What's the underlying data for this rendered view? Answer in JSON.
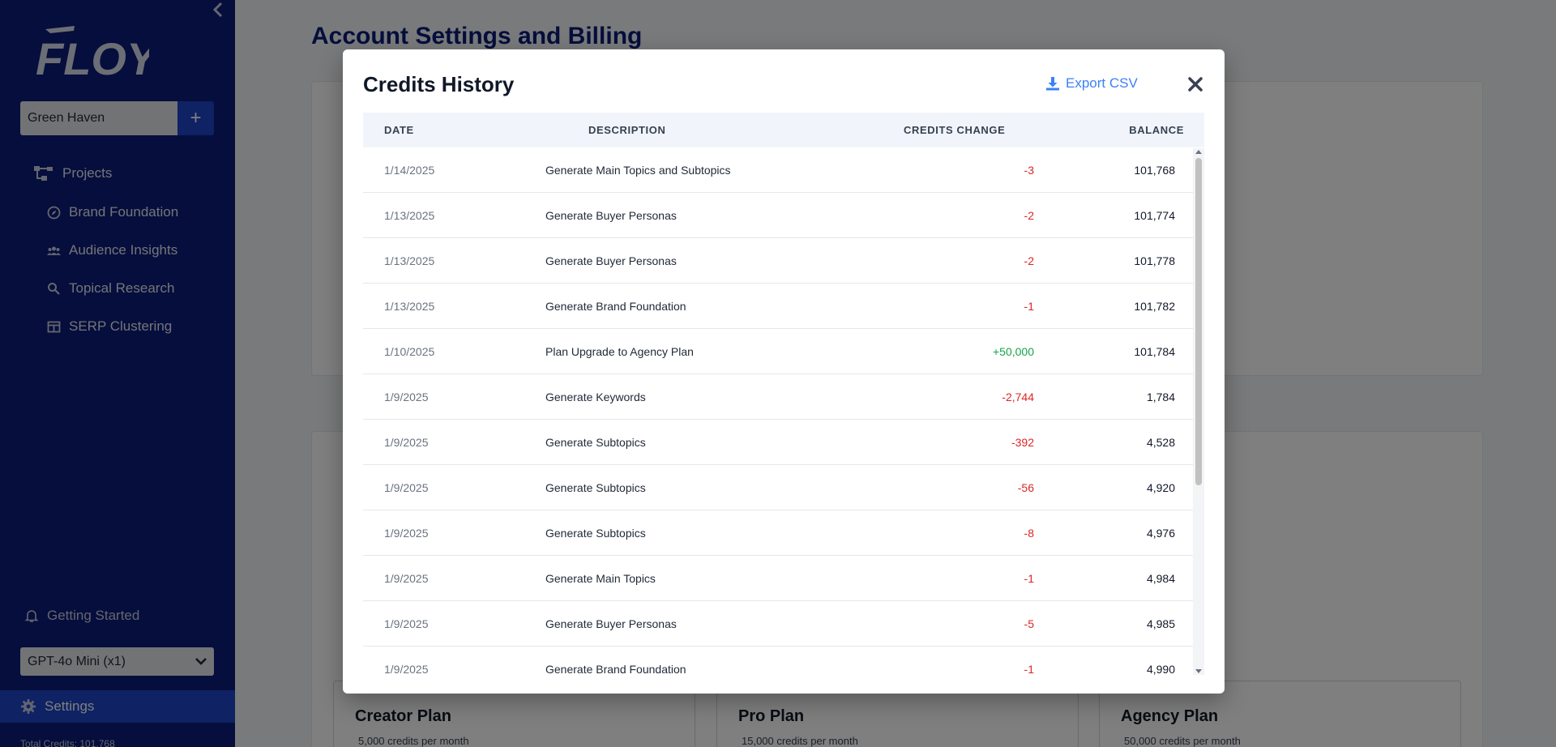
{
  "sidebar": {
    "logo_text": "FLOYI",
    "project": {
      "name": "Green Haven",
      "add_label": "+"
    },
    "nav": [
      {
        "label": "Projects",
        "icon": "projects-tree-icon"
      },
      {
        "label": "Brand Foundation",
        "icon": "compass-icon"
      },
      {
        "label": "Audience Insights",
        "icon": "users-icon"
      },
      {
        "label": "Topical Research",
        "icon": "search-icon"
      },
      {
        "label": "SERP Clustering",
        "icon": "table-icon"
      }
    ],
    "getting_started": "Getting Started",
    "model": "GPT-4o Mini (x1)",
    "settings": "Settings",
    "total_credits": "Total Credits: 101,768"
  },
  "main": {
    "title": "Account Settings and Billing",
    "plans": [
      {
        "name": "Creator Plan",
        "desc": "5,000 credits per month"
      },
      {
        "name": "Pro Plan",
        "desc": "15,000 credits per month"
      },
      {
        "name": "Agency Plan",
        "desc": "50,000 credits per month"
      }
    ]
  },
  "modal": {
    "title": "Credits History",
    "export_label": "Export CSV",
    "columns": {
      "date": "DATE",
      "description": "DESCRIPTION",
      "change": "CREDITS CHANGE",
      "balance": "BALANCE"
    },
    "rows": [
      {
        "date": "1/14/2025",
        "description": "Generate Main Topics and Subtopics",
        "change": "-3",
        "balance": "101,768"
      },
      {
        "date": "1/13/2025",
        "description": "Generate Buyer Personas",
        "change": "-2",
        "balance": "101,774"
      },
      {
        "date": "1/13/2025",
        "description": "Generate Buyer Personas",
        "change": "-2",
        "balance": "101,778"
      },
      {
        "date": "1/13/2025",
        "description": "Generate Brand Foundation",
        "change": "-1",
        "balance": "101,782"
      },
      {
        "date": "1/10/2025",
        "description": "Plan Upgrade to Agency Plan",
        "change": "+50,000",
        "balance": "101,784"
      },
      {
        "date": "1/9/2025",
        "description": "Generate Keywords",
        "change": "-2,744",
        "balance": "1,784"
      },
      {
        "date": "1/9/2025",
        "description": "Generate Subtopics",
        "change": "-392",
        "balance": "4,528"
      },
      {
        "date": "1/9/2025",
        "description": "Generate Subtopics",
        "change": "-56",
        "balance": "4,920"
      },
      {
        "date": "1/9/2025",
        "description": "Generate Subtopics",
        "change": "-8",
        "balance": "4,976"
      },
      {
        "date": "1/9/2025",
        "description": "Generate Main Topics",
        "change": "-1",
        "balance": "4,984"
      },
      {
        "date": "1/9/2025",
        "description": "Generate Buyer Personas",
        "change": "-5",
        "balance": "4,985"
      },
      {
        "date": "1/9/2025",
        "description": "Generate Brand Foundation",
        "change": "-1",
        "balance": "4,990"
      }
    ]
  },
  "colors": {
    "sidebar_bg": "#0b1d78",
    "accent": "#1d44c8",
    "negative": "#dc2626",
    "positive": "#16a34a",
    "link": "#3b82f6"
  }
}
